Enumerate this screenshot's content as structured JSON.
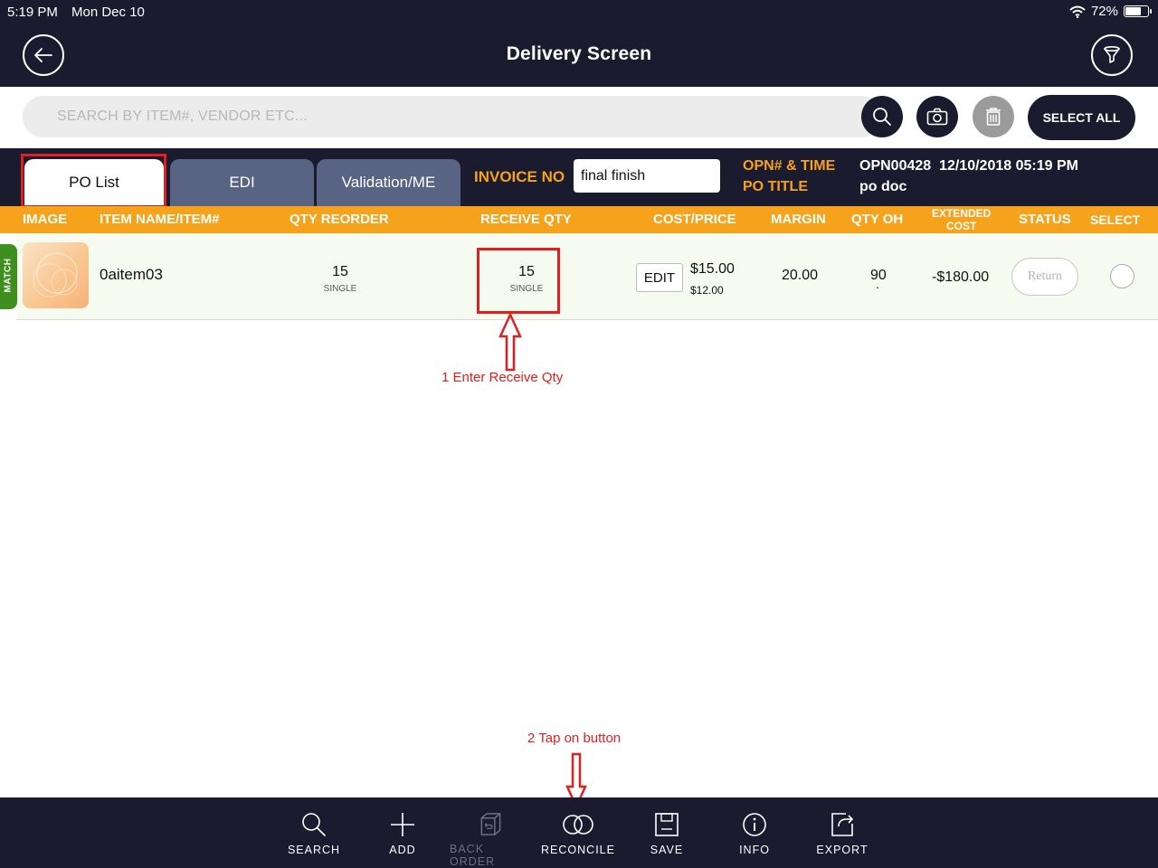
{
  "status_bar": {
    "time": "5:19 PM",
    "date": "Mon Dec 10",
    "battery": "72%",
    "battery_level": 0.72
  },
  "header": {
    "title": "Delivery Screen",
    "back_icon": "arrow-left-icon",
    "filter_icon": "filter-funnel-icon"
  },
  "search": {
    "placeholder": "SEARCH BY ITEM#, VENDOR ETC...",
    "value": "",
    "select_all_label": "SELECT ALL"
  },
  "tabs": [
    {
      "label": "PO List",
      "active": true
    },
    {
      "label": "EDI",
      "active": false
    },
    {
      "label": "Validation/ME",
      "active": false
    }
  ],
  "invoice": {
    "label": "INVOICE NO",
    "value": "final finish"
  },
  "po_info": {
    "opn_label": "OPN# & TIME",
    "opn_value": "OPN00428  12/10/2018 05:19 PM",
    "title_label": "PO TITLE",
    "title_value": "po doc"
  },
  "columns": {
    "image": "IMAGE",
    "item": "ITEM NAME/ITEM#",
    "qty_reorder": "QTY REORDER",
    "receive_qty": "RECEIVE QTY",
    "cost_price": "COST/PRICE",
    "margin": "MARGIN",
    "qty_oh": "QTY OH",
    "extended_cost_1": "EXTENDED",
    "extended_cost_2": "COST",
    "status": "STATUS",
    "select": "SELECT"
  },
  "row": {
    "match_label": "MATCH",
    "item_name": "0aitem03",
    "qty_reorder": "15",
    "qty_reorder_unit": "SINGLE",
    "receive_qty": "15",
    "receive_qty_unit": "SINGLE",
    "edit_label": "EDIT",
    "cost": "$15.00",
    "price": "$12.00",
    "margin": "20.00",
    "qty_oh": "90",
    "qty_oh_sub": ".",
    "extended_cost": "-$180.00",
    "status_label": "Return"
  },
  "annotations": {
    "step1": "1 Enter Receive Qty",
    "step2": "2 Tap on button"
  },
  "toolbar": [
    {
      "label": "SEARCH",
      "icon": "search-icon",
      "enabled": true
    },
    {
      "label": "ADD",
      "icon": "plus-icon",
      "enabled": true
    },
    {
      "label": "BACK ORDER",
      "icon": "box-return-icon",
      "enabled": false
    },
    {
      "label": "RECONCILE",
      "icon": "reconcile-circles-icon",
      "enabled": true
    },
    {
      "label": "SAVE",
      "icon": "save-icon",
      "enabled": true
    },
    {
      "label": "INFO",
      "icon": "info-icon",
      "enabled": true
    },
    {
      "label": "EXPORT",
      "icon": "export-icon",
      "enabled": true
    }
  ],
  "colors": {
    "navy": "#1b1b2f",
    "orange": "#f7a21b",
    "tab_inactive": "#596383",
    "match_green": "#3f8f1f",
    "annotation_red": "#e02020"
  }
}
